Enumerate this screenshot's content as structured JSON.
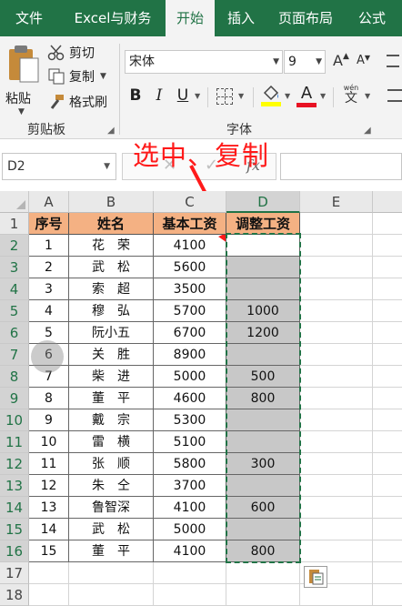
{
  "ribbon_tabs": [
    {
      "label": "文件",
      "active": false
    },
    {
      "label": "Excel与财务",
      "active": false
    },
    {
      "label": "开始",
      "active": true
    },
    {
      "label": "插入",
      "active": false
    },
    {
      "label": "页面布局",
      "active": false
    },
    {
      "label": "公式",
      "active": false
    }
  ],
  "clipboard": {
    "paste_label": "粘贴",
    "cut_label": "剪切",
    "copy_label": "复制",
    "format_painter_label": "格式刷",
    "group_label": "剪贴板"
  },
  "font": {
    "font_name": "宋体",
    "font_size": "9",
    "group_label": "字体",
    "bold": "B",
    "italic": "I",
    "underline": "U",
    "grow": "A",
    "shrink": "A",
    "font_color": "A",
    "phonetic": "wén"
  },
  "name_box": "D2",
  "annotation": "选中、复制",
  "columns": [
    "A",
    "B",
    "C",
    "D",
    "E"
  ],
  "selected_column": "D",
  "rows": [
    "1",
    "2",
    "3",
    "4",
    "5",
    "6",
    "7",
    "8",
    "9",
    "10",
    "11",
    "12",
    "13",
    "14",
    "15",
    "16",
    "17",
    "18"
  ],
  "table_headers": [
    "序号",
    "姓名",
    "基本工资",
    "调整工资"
  ],
  "table_rows": [
    {
      "no": "1",
      "name": "花　荣",
      "base": "4100",
      "adj": ""
    },
    {
      "no": "2",
      "name": "武　松",
      "base": "5600",
      "adj": ""
    },
    {
      "no": "3",
      "name": "索　超",
      "base": "3500",
      "adj": ""
    },
    {
      "no": "4",
      "name": "穆　弘",
      "base": "5700",
      "adj": "1000"
    },
    {
      "no": "5",
      "name": "阮小五",
      "base": "6700",
      "adj": "1200"
    },
    {
      "no": "6",
      "name": "关　胜",
      "base": "8900",
      "adj": ""
    },
    {
      "no": "7",
      "name": "柴　进",
      "base": "5000",
      "adj": "500"
    },
    {
      "no": "8",
      "name": "董　平",
      "base": "4600",
      "adj": "800"
    },
    {
      "no": "9",
      "name": "戴　宗",
      "base": "5300",
      "adj": ""
    },
    {
      "no": "10",
      "name": "雷　横",
      "base": "5100",
      "adj": ""
    },
    {
      "no": "11",
      "name": "张　顺",
      "base": "5800",
      "adj": "300"
    },
    {
      "no": "12",
      "name": "朱　仝",
      "base": "3700",
      "adj": ""
    },
    {
      "no": "13",
      "name": "鲁智深",
      "base": "4100",
      "adj": "600"
    },
    {
      "no": "14",
      "name": "武　松",
      "base": "5000",
      "adj": ""
    },
    {
      "no": "15",
      "name": "董　平",
      "base": "4100",
      "adj": "800"
    }
  ],
  "colors": {
    "excel_green": "#217346",
    "header_fill": "#f4b183",
    "selection_fill": "#c8c8c8",
    "annotation_red": "#ff1a1a"
  }
}
